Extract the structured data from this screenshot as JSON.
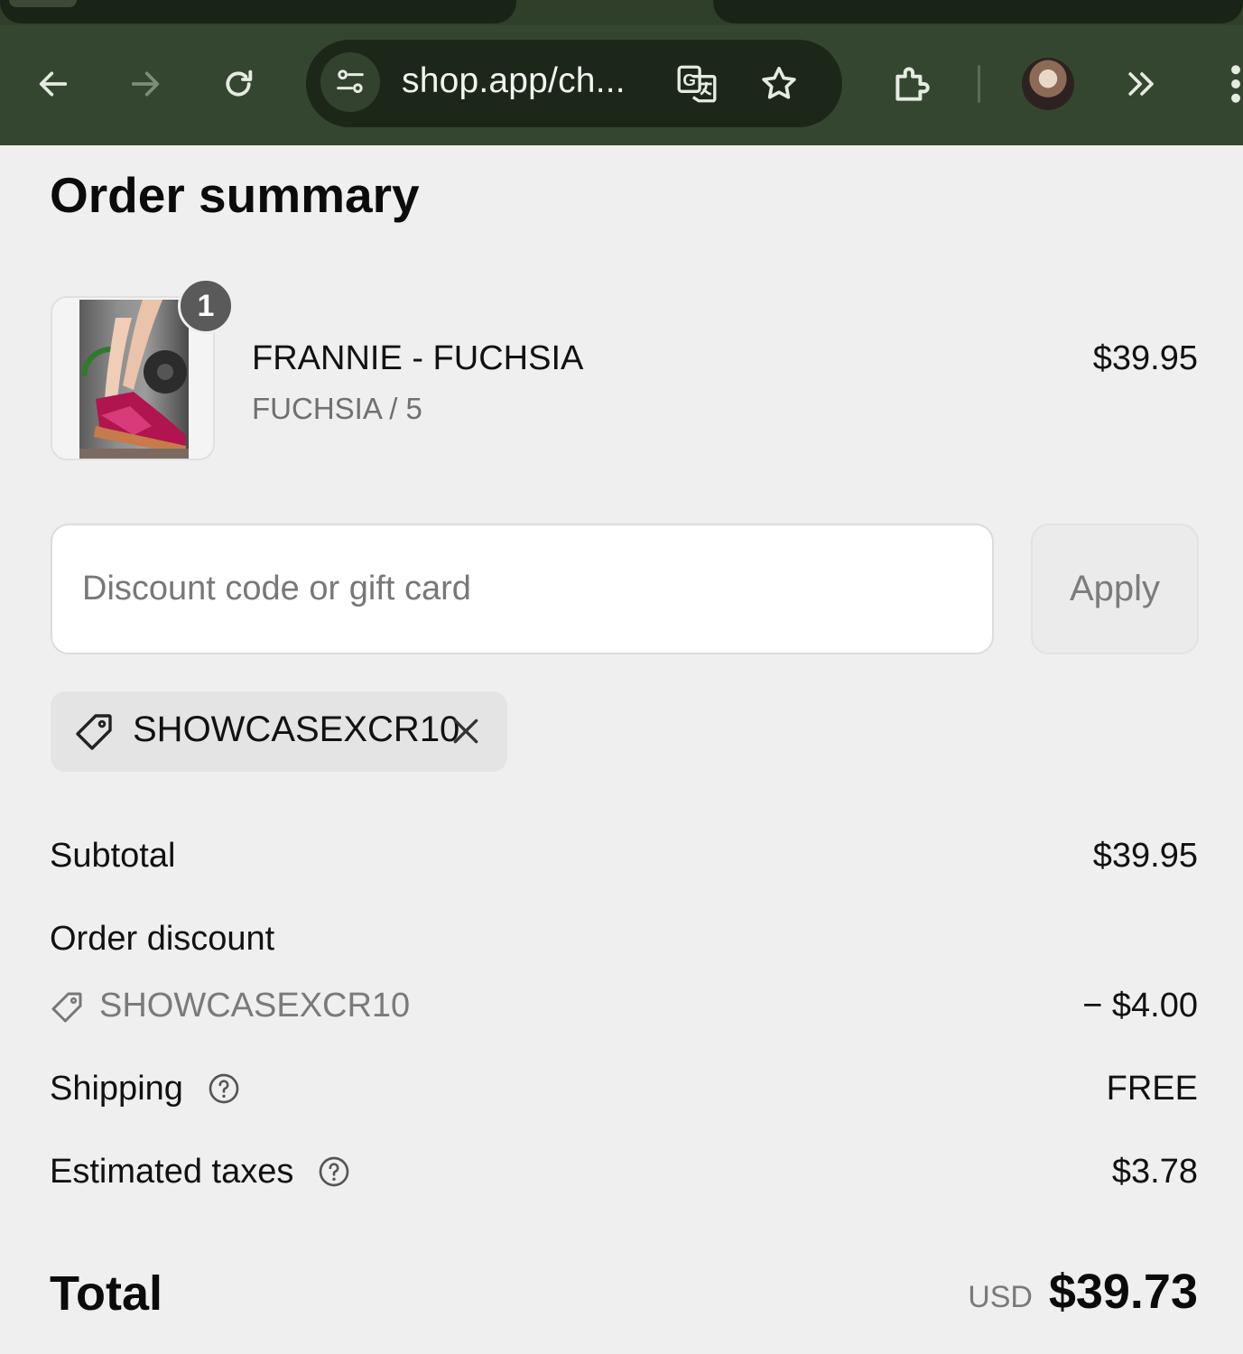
{
  "browser": {
    "url": "shop.app/ch...",
    "icons": [
      "back-icon",
      "forward-icon",
      "reload-icon",
      "site-info-icon",
      "translate-icon",
      "bookmark-star-icon",
      "extensions-icon",
      "profile-avatar",
      "more-tools-chevron-icon",
      "menu-kebab-icon"
    ],
    "colors": {
      "toolbar": "#344630",
      "omnibox": "#1d2719",
      "tabstrip": "#2f3f2a"
    }
  },
  "summary": {
    "title": "Order summary",
    "item": {
      "quantity": "1",
      "name": "FRANNIE - FUCHSIA",
      "variant": "FUCHSIA / 5",
      "price": "$39.95"
    },
    "discount": {
      "placeholder": "Discount code or gift card",
      "value": "",
      "apply_label": "Apply",
      "applied_code": "SHOWCASEXCR10"
    },
    "rows": {
      "subtotal_label": "Subtotal",
      "subtotal_value": "$39.95",
      "discount_label": "Order discount",
      "discount_code": "SHOWCASEXCR10",
      "discount_value": "− $4.00",
      "shipping_label": "Shipping",
      "shipping_value": "FREE",
      "taxes_label": "Estimated taxes",
      "taxes_value": "$3.78"
    },
    "total": {
      "label": "Total",
      "currency": "USD",
      "value": "$39.73"
    }
  }
}
